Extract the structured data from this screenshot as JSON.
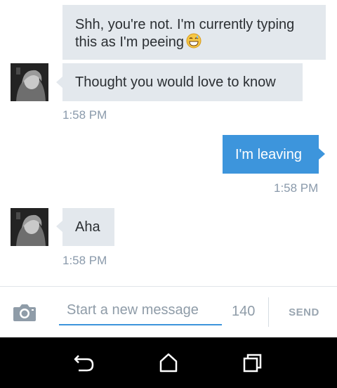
{
  "messages": [
    {
      "direction": "incoming",
      "text": "Shh, you're not. I'm currently typing this as I'm peeing",
      "emoji": "grinning-sweat-emoji"
    },
    {
      "direction": "incoming",
      "text": "Thought you would love to know",
      "time": "1:58 PM"
    },
    {
      "direction": "outgoing",
      "text": "I'm leaving",
      "time": "1:58 PM"
    },
    {
      "direction": "incoming",
      "text": "Aha",
      "time": "1:58 PM"
    }
  ],
  "composer": {
    "placeholder": "Start a new message",
    "value": "",
    "char_count": "140",
    "send_label": "SEND",
    "camera_icon": "camera-icon"
  },
  "navbar": {
    "icons": [
      "back-icon",
      "home-icon",
      "recent-apps-icon"
    ]
  },
  "colors": {
    "incoming_bubble": "#e3e8ed",
    "outgoing_bubble": "#3d95dc",
    "timestamp": "#8a9aab",
    "accent": "#3d95dc"
  }
}
